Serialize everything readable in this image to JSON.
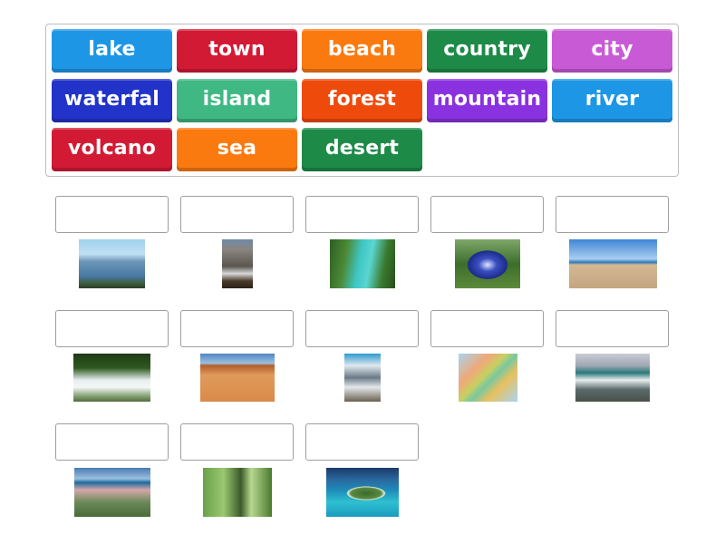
{
  "word_bank": [
    {
      "label": "lake",
      "color": "#1e96e6"
    },
    {
      "label": "town",
      "color": "#d31a35"
    },
    {
      "label": "beach",
      "color": "#fb7a10"
    },
    {
      "label": "country",
      "color": "#1e8a48"
    },
    {
      "label": "city",
      "color": "#c95ad6"
    },
    {
      "label": "waterfal",
      "color": "#2133c8"
    },
    {
      "label": "island",
      "color": "#3fb883"
    },
    {
      "label": "forest",
      "color": "#ee4a0c"
    },
    {
      "label": "mountain",
      "color": "#8a32e0"
    },
    {
      "label": "river",
      "color": "#1e96e6"
    },
    {
      "label": "volcano",
      "color": "#d31a35"
    },
    {
      "label": "sea",
      "color": "#fb7a10"
    },
    {
      "label": "desert",
      "color": "#1e8a48"
    }
  ],
  "answer_slots": [
    {
      "image": "city-skyline",
      "value": ""
    },
    {
      "image": "volcano-eruption",
      "value": ""
    },
    {
      "image": "turquoise-river",
      "value": ""
    },
    {
      "image": "crater-lake",
      "value": ""
    },
    {
      "image": "sandy-beach",
      "value": ""
    },
    {
      "image": "waterfall",
      "value": ""
    },
    {
      "image": "desert-dunes",
      "value": ""
    },
    {
      "image": "snowy-mountain",
      "value": ""
    },
    {
      "image": "europe-map",
      "value": ""
    },
    {
      "image": "ocean-waves",
      "value": ""
    },
    {
      "image": "coastal-town",
      "value": ""
    },
    {
      "image": "green-forest",
      "value": ""
    },
    {
      "image": "tropical-island",
      "value": ""
    }
  ]
}
